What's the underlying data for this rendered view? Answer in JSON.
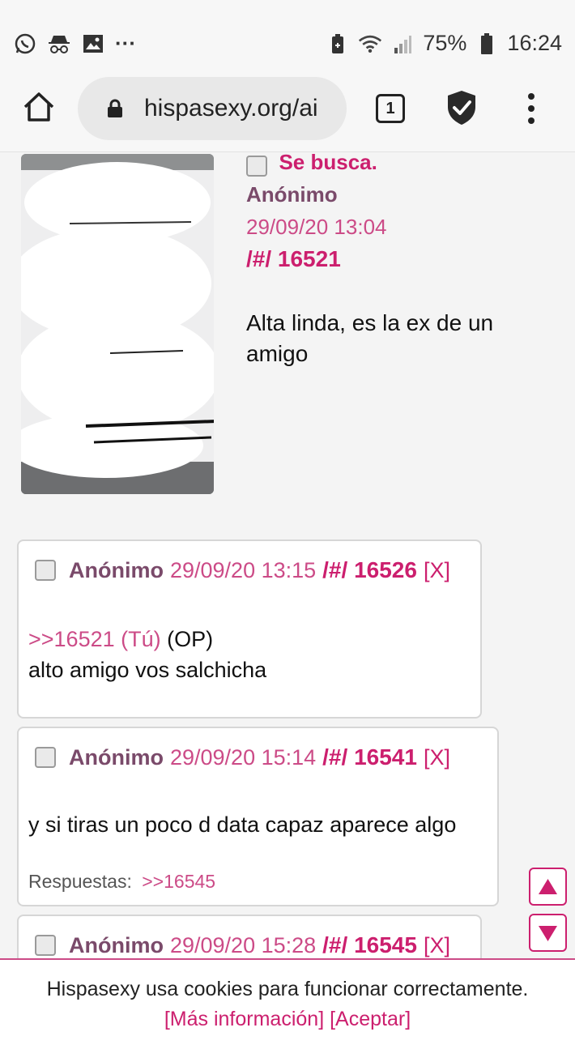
{
  "status_bar": {
    "left_icons": [
      "whatsapp-icon",
      "incognito-icon",
      "gallery-icon",
      "more-notifications-icon"
    ],
    "more_text": "···",
    "battery": "75%",
    "time": "16:24"
  },
  "browser": {
    "url": "hispasexy.org/ai",
    "tab_count": "1"
  },
  "op_post": {
    "subject": "Se busca.",
    "name": "Anónimo",
    "date": "29/09/20 13:04",
    "number": "/#/ 16521",
    "body_lines": [
      "Alta linda, es la ex de un",
      "amigo"
    ]
  },
  "replies": [
    {
      "name": "Anónimo",
      "date": "29/09/20 13:15",
      "number": "/#/ 16526",
      "x": "[X]",
      "quote": ">>16521 (Tú)",
      "quote_suffix": " (OP)",
      "body": "alto amigo vos salchicha"
    },
    {
      "name": "Anónimo",
      "date": "29/09/20 15:14",
      "number": "/#/ 16541",
      "x": "[X]",
      "body": "y si tiras un poco d data capaz aparece algo",
      "replies_label": "Respuestas:",
      "replies_link": ">>16545"
    },
    {
      "name": "Anónimo",
      "date": "29/09/20 15:28",
      "number": "/#/ 16545",
      "x": "[X]"
    }
  ],
  "cookie": {
    "text": "Hispasexy usa cookies para funcionar correctamente.",
    "more_info": "[Más información]",
    "accept": "[Aceptar]"
  }
}
